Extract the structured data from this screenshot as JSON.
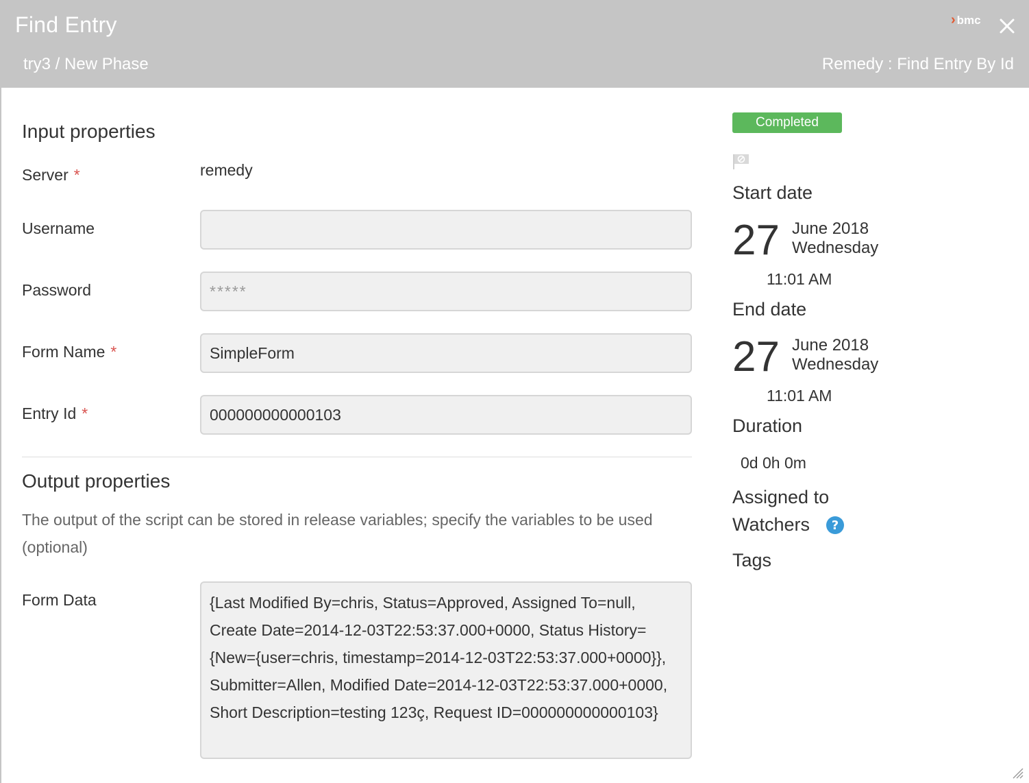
{
  "dialog": {
    "title": "Find Entry",
    "breadcrumb": "try3 / New Phase",
    "task_type": "Remedy : Find Entry By Id",
    "logo_text": "bmc"
  },
  "input": {
    "section_title": "Input properties",
    "server_label": "Server",
    "server_value": "remedy",
    "username_label": "Username",
    "username_value": "",
    "password_label": "Password",
    "password_placeholder": "*****",
    "form_name_label": "Form Name",
    "form_name_value": "SimpleForm",
    "entry_id_label": "Entry Id",
    "entry_id_value": "000000000000103",
    "required_mark": "*"
  },
  "output": {
    "section_title": "Output properties",
    "help_text": "The output of the script can be stored in release variables; specify the variables to be used (optional)",
    "form_data_label": "Form Data",
    "form_data_value": "{Last Modified By=chris, Status=Approved, Assigned To=null, Create Date=2014-12-03T22:53:37.000+0000, Status History={New={user=chris, timestamp=2014-12-03T22:53:37.000+0000}}, Submitter=Allen, Modified Date=2014-12-03T22:53:37.000+0000, Short Description=testing 123ç, Request ID=000000000000103}"
  },
  "sidebar": {
    "status": "Completed",
    "status_color": "#5cb85c",
    "start_heading": "Start date",
    "start_day": "27",
    "start_month_year": "June 2018",
    "start_weekday": "Wednesday",
    "start_time": "11:01 AM",
    "end_heading": "End date",
    "end_day": "27",
    "end_month_year": "June 2018",
    "end_weekday": "Wednesday",
    "end_time": "11:01 AM",
    "duration_heading": "Duration",
    "duration_value": "0d 0h 0m",
    "assigned_heading": "Assigned to",
    "watchers_heading": "Watchers",
    "tags_heading": "Tags"
  },
  "icons": {
    "close": "close-icon",
    "flag": "flag-icon",
    "help": "help-icon",
    "resize": "resize-handle-icon"
  }
}
